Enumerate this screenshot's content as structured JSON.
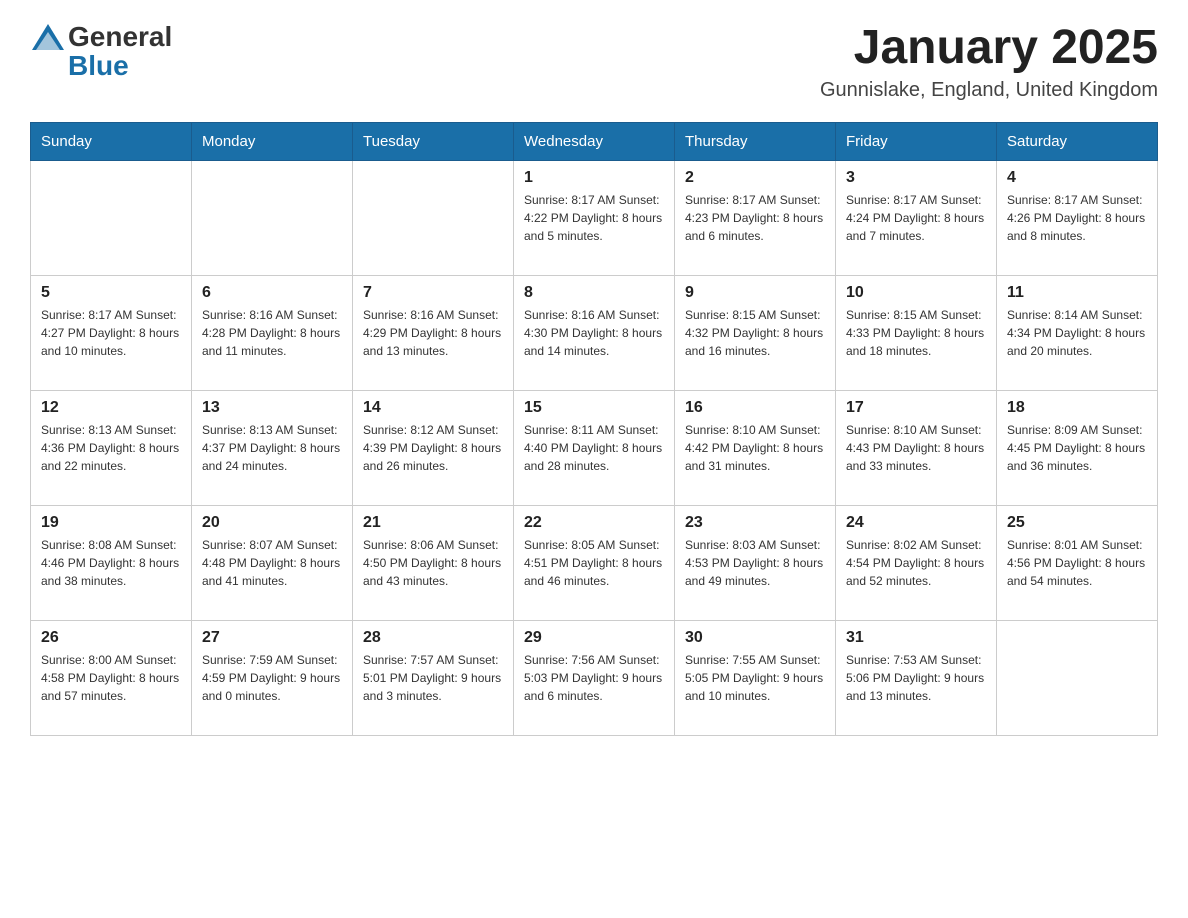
{
  "header": {
    "title": "January 2025",
    "subtitle": "Gunnislake, England, United Kingdom",
    "logo_general": "General",
    "logo_blue": "Blue"
  },
  "weekdays": [
    "Sunday",
    "Monday",
    "Tuesday",
    "Wednesday",
    "Thursday",
    "Friday",
    "Saturday"
  ],
  "weeks": [
    [
      {
        "day": "",
        "info": ""
      },
      {
        "day": "",
        "info": ""
      },
      {
        "day": "",
        "info": ""
      },
      {
        "day": "1",
        "info": "Sunrise: 8:17 AM\nSunset: 4:22 PM\nDaylight: 8 hours\nand 5 minutes."
      },
      {
        "day": "2",
        "info": "Sunrise: 8:17 AM\nSunset: 4:23 PM\nDaylight: 8 hours\nand 6 minutes."
      },
      {
        "day": "3",
        "info": "Sunrise: 8:17 AM\nSunset: 4:24 PM\nDaylight: 8 hours\nand 7 minutes."
      },
      {
        "day": "4",
        "info": "Sunrise: 8:17 AM\nSunset: 4:26 PM\nDaylight: 8 hours\nand 8 minutes."
      }
    ],
    [
      {
        "day": "5",
        "info": "Sunrise: 8:17 AM\nSunset: 4:27 PM\nDaylight: 8 hours\nand 10 minutes."
      },
      {
        "day": "6",
        "info": "Sunrise: 8:16 AM\nSunset: 4:28 PM\nDaylight: 8 hours\nand 11 minutes."
      },
      {
        "day": "7",
        "info": "Sunrise: 8:16 AM\nSunset: 4:29 PM\nDaylight: 8 hours\nand 13 minutes."
      },
      {
        "day": "8",
        "info": "Sunrise: 8:16 AM\nSunset: 4:30 PM\nDaylight: 8 hours\nand 14 minutes."
      },
      {
        "day": "9",
        "info": "Sunrise: 8:15 AM\nSunset: 4:32 PM\nDaylight: 8 hours\nand 16 minutes."
      },
      {
        "day": "10",
        "info": "Sunrise: 8:15 AM\nSunset: 4:33 PM\nDaylight: 8 hours\nand 18 minutes."
      },
      {
        "day": "11",
        "info": "Sunrise: 8:14 AM\nSunset: 4:34 PM\nDaylight: 8 hours\nand 20 minutes."
      }
    ],
    [
      {
        "day": "12",
        "info": "Sunrise: 8:13 AM\nSunset: 4:36 PM\nDaylight: 8 hours\nand 22 minutes."
      },
      {
        "day": "13",
        "info": "Sunrise: 8:13 AM\nSunset: 4:37 PM\nDaylight: 8 hours\nand 24 minutes."
      },
      {
        "day": "14",
        "info": "Sunrise: 8:12 AM\nSunset: 4:39 PM\nDaylight: 8 hours\nand 26 minutes."
      },
      {
        "day": "15",
        "info": "Sunrise: 8:11 AM\nSunset: 4:40 PM\nDaylight: 8 hours\nand 28 minutes."
      },
      {
        "day": "16",
        "info": "Sunrise: 8:10 AM\nSunset: 4:42 PM\nDaylight: 8 hours\nand 31 minutes."
      },
      {
        "day": "17",
        "info": "Sunrise: 8:10 AM\nSunset: 4:43 PM\nDaylight: 8 hours\nand 33 minutes."
      },
      {
        "day": "18",
        "info": "Sunrise: 8:09 AM\nSunset: 4:45 PM\nDaylight: 8 hours\nand 36 minutes."
      }
    ],
    [
      {
        "day": "19",
        "info": "Sunrise: 8:08 AM\nSunset: 4:46 PM\nDaylight: 8 hours\nand 38 minutes."
      },
      {
        "day": "20",
        "info": "Sunrise: 8:07 AM\nSunset: 4:48 PM\nDaylight: 8 hours\nand 41 minutes."
      },
      {
        "day": "21",
        "info": "Sunrise: 8:06 AM\nSunset: 4:50 PM\nDaylight: 8 hours\nand 43 minutes."
      },
      {
        "day": "22",
        "info": "Sunrise: 8:05 AM\nSunset: 4:51 PM\nDaylight: 8 hours\nand 46 minutes."
      },
      {
        "day": "23",
        "info": "Sunrise: 8:03 AM\nSunset: 4:53 PM\nDaylight: 8 hours\nand 49 minutes."
      },
      {
        "day": "24",
        "info": "Sunrise: 8:02 AM\nSunset: 4:54 PM\nDaylight: 8 hours\nand 52 minutes."
      },
      {
        "day": "25",
        "info": "Sunrise: 8:01 AM\nSunset: 4:56 PM\nDaylight: 8 hours\nand 54 minutes."
      }
    ],
    [
      {
        "day": "26",
        "info": "Sunrise: 8:00 AM\nSunset: 4:58 PM\nDaylight: 8 hours\nand 57 minutes."
      },
      {
        "day": "27",
        "info": "Sunrise: 7:59 AM\nSunset: 4:59 PM\nDaylight: 9 hours\nand 0 minutes."
      },
      {
        "day": "28",
        "info": "Sunrise: 7:57 AM\nSunset: 5:01 PM\nDaylight: 9 hours\nand 3 minutes."
      },
      {
        "day": "29",
        "info": "Sunrise: 7:56 AM\nSunset: 5:03 PM\nDaylight: 9 hours\nand 6 minutes."
      },
      {
        "day": "30",
        "info": "Sunrise: 7:55 AM\nSunset: 5:05 PM\nDaylight: 9 hours\nand 10 minutes."
      },
      {
        "day": "31",
        "info": "Sunrise: 7:53 AM\nSunset: 5:06 PM\nDaylight: 9 hours\nand 13 minutes."
      },
      {
        "day": "",
        "info": ""
      }
    ]
  ]
}
